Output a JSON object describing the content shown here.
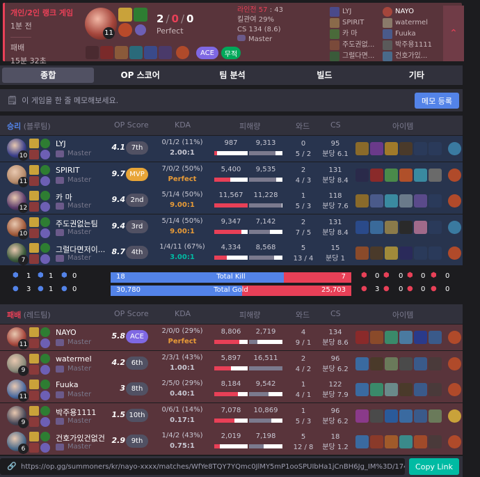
{
  "summary": {
    "mode": "개인/2인 랭크 게임",
    "ago": "1분 전",
    "result": "패배",
    "duration": "15분 32초",
    "level": "11",
    "kills": "2",
    "deaths": "0",
    "assists": "0",
    "sep": "/",
    "perfect": "Perfect",
    "laning": "라인전 57 : 43",
    "laning_prefix": "라인전 ",
    "laning_value": "57",
    "laning_rest": " : 43",
    "kill_participation": "킬관여 29%",
    "cs": "CS 134 (8.6)",
    "tier": "Master",
    "ace_badge": "ACE",
    "mvp_badge": "무적",
    "team_left": [
      "LYJ",
      "SPIRIT",
      "카 마",
      "주도권없...",
      "그럴다면..."
    ],
    "team_right": [
      "NAYO",
      "watermel",
      "Fuuka",
      "박주용1111",
      "건호가있..."
    ]
  },
  "tabs": [
    "종합",
    "OP 스코어",
    "팀 분석",
    "빌드",
    "기타"
  ],
  "memo": {
    "placeholder": "이 게임을 한 줄 메모해보세요.",
    "button": "메모 등록"
  },
  "blue_header": {
    "result": "승리",
    "team": "(블루팀)",
    "op": "OP Score",
    "kda": "KDA",
    "dmg": "피해량",
    "ward": "와드",
    "cs": "CS",
    "items": "아이템"
  },
  "red_header": {
    "result": "패배",
    "team": "(레드팀)",
    "op": "OP Score",
    "kda": "KDA",
    "dmg": "피해량",
    "ward": "와드",
    "cs": "CS",
    "items": "아이템"
  },
  "blue_players": [
    {
      "name": "LYJ",
      "tier": "Master",
      "level": "10",
      "score": "4.1",
      "rank": "7th",
      "kda": "0/1/2 (11%)",
      "ratio": "2.00:1",
      "dealt": "987",
      "taken": "9,313",
      "dealt_pct": 0.09,
      "taken_pct": 0.8,
      "ward": "0",
      "ward2": "5 / 2",
      "cs": "95",
      "cspm": "분당 6.1"
    },
    {
      "name": "SPIRIT",
      "tier": "Master",
      "level": "11",
      "score": "9.7",
      "rank": "MVP",
      "kda": "7/0/2 (50%)",
      "ratio": "Perfect",
      "dealt": "5,400",
      "taken": "9,535",
      "dealt_pct": 0.47,
      "taken_pct": 0.82,
      "ward": "2",
      "ward2": "4 / 3",
      "cs": "131",
      "cspm": "분당 8.4"
    },
    {
      "name": "카 마",
      "tier": "Master",
      "level": "12",
      "score": "9.4",
      "rank": "2nd",
      "kda": "5/1/4 (50%)",
      "ratio": "9.00:1",
      "dealt": "11,567",
      "taken": "11,228",
      "dealt_pct": 1.0,
      "taken_pct": 0.97,
      "ward": "1",
      "ward2": "5 / 3",
      "cs": "118",
      "cspm": "분당 7.6"
    },
    {
      "name": "주도권없는팀",
      "tier": "Master",
      "level": "10",
      "score": "9.4",
      "rank": "3rd",
      "kda": "5/1/4 (50%)",
      "ratio": "9.00:1",
      "dealt": "9,347",
      "taken": "7,142",
      "dealt_pct": 0.81,
      "taken_pct": 0.62,
      "ward": "2",
      "ward2": "7 / 5",
      "cs": "131",
      "cspm": "분당 8.4"
    },
    {
      "name": "그럴다면저이...",
      "tier": "Master",
      "level": "7",
      "score": "8.7",
      "rank": "4th",
      "kda": "1/4/11 (67%)",
      "ratio": "3.00:1",
      "dealt": "4,334",
      "taken": "8,568",
      "dealt_pct": 0.37,
      "taken_pct": 0.74,
      "ward": "5",
      "ward2": "13 / 4",
      "cs": "15",
      "cspm": "분당 1"
    }
  ],
  "red_players": [
    {
      "name": "NAYO",
      "tier": "Master",
      "level": "11",
      "score": "5.8",
      "rank": "ACE",
      "kda": "2/0/0 (29%)",
      "ratio": "Perfect",
      "dealt": "8,806",
      "taken": "2,719",
      "dealt_pct": 0.76,
      "taken_pct": 0.24,
      "ward": "4",
      "ward2": "9 / 1",
      "cs": "134",
      "cspm": "분당 8.6"
    },
    {
      "name": "watermel",
      "tier": "Master",
      "level": "9",
      "score": "4.2",
      "rank": "6th",
      "kda": "2/3/1 (43%)",
      "ratio": "1.00:1",
      "dealt": "5,897",
      "taken": "16,511",
      "dealt_pct": 0.51,
      "taken_pct": 1.0,
      "ward": "2",
      "ward2": "4 / 2",
      "cs": "96",
      "cspm": "분당 6.2"
    },
    {
      "name": "Fuuka",
      "tier": "Master",
      "level": "11",
      "score": "3",
      "rank": "8th",
      "kda": "2/5/0 (29%)",
      "ratio": "0.40:1",
      "dealt": "8,184",
      "taken": "9,542",
      "dealt_pct": 0.71,
      "taken_pct": 0.58,
      "ward": "1",
      "ward2": "4 / 1",
      "cs": "122",
      "cspm": "분당 7.9"
    },
    {
      "name": "박주용1111",
      "tier": "Master",
      "level": "9",
      "score": "1.5",
      "rank": "10th",
      "kda": "0/6/1 (14%)",
      "ratio": "0.17:1",
      "dealt": "7,078",
      "taken": "10,869",
      "dealt_pct": 0.61,
      "taken_pct": 0.66,
      "ward": "1",
      "ward2": "5 / 3",
      "cs": "96",
      "cspm": "분당 6.2"
    },
    {
      "name": "건호가있건없건",
      "tier": "Master",
      "level": "6",
      "score": "2.9",
      "rank": "9th",
      "kda": "1/4/2 (43%)",
      "ratio": "0.75:1",
      "dealt": "2,019",
      "taken": "7,198",
      "dealt_pct": 0.17,
      "taken_pct": 0.44,
      "ward": "5",
      "ward2": "12 / 8",
      "cs": "18",
      "cspm": "분당 1.2"
    }
  ],
  "objectives": {
    "blue": [
      "1",
      "1",
      "0",
      "3",
      "1",
      "0"
    ],
    "red": [
      "0",
      "0",
      "0",
      "0",
      "3",
      "0",
      "0",
      "0"
    ],
    "total_kill_label": "Total Kill",
    "total_gold_label": "Total Gold",
    "blue_kill": "18",
    "red_kill": "7",
    "kill_share": 0.72,
    "blue_gold": "30,780",
    "red_gold": "25,703",
    "gold_share": 0.545
  },
  "url": "https://op.gg/summoners/kr/nayo-xxxx/matches/WfYe8TQY7YQmc0JlMY5mP1ooSPUIbHa1jCnBH6Jg_IM%3D/17453...",
  "copy_label": "Copy Link",
  "colors": {
    "win": "#5383e8",
    "lose": "#e84057",
    "mvp": "#e8a537",
    "ace": "#7f68e3",
    "rank": "#515163",
    "blue_row": "#28344e",
    "red_row": "#59343b"
  }
}
